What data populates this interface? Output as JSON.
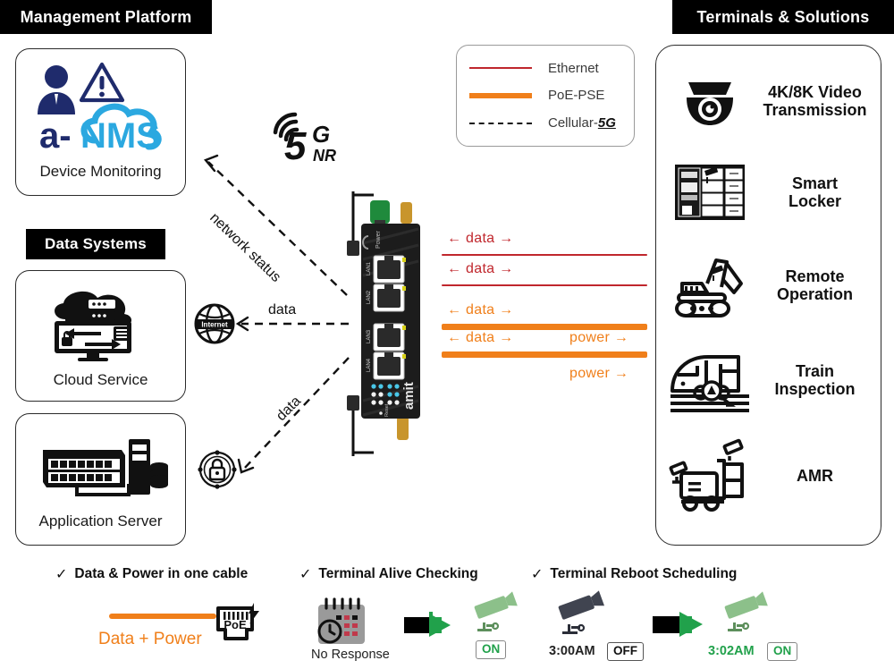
{
  "sections": {
    "management_platform": "Management Platform",
    "data_systems": "Data Systems",
    "terminals_solutions": "Terminals & Solutions"
  },
  "colors": {
    "ethernet_red": "#C0272D",
    "poe_orange": "#F07F1A",
    "cellular_black": "#111111",
    "logo_navy": "#1F2B6C",
    "logo_cyan": "#2BA8E0",
    "green": "#21A14B"
  },
  "cards": {
    "device_monitoring": {
      "label": "Device Monitoring",
      "logo_a": "a-",
      "logo_nms": "NMS"
    },
    "cloud_service": {
      "label": "Cloud Service"
    },
    "application_server": {
      "label": "Application Server"
    }
  },
  "legend": {
    "items": [
      {
        "label": "Ethernet",
        "style": "solid",
        "color": "#C0272D",
        "thickness": 2
      },
      {
        "label": "PoE-PSE",
        "style": "solid",
        "color": "#F07F1A",
        "thickness": 6
      },
      {
        "label": "Cellular-",
        "emphasis": "5G",
        "style": "dashed",
        "color": "#111111",
        "thickness": 2
      }
    ]
  },
  "center": {
    "cellular_badge": {
      "main": "5",
      "sup": "G",
      "sub": "NR"
    },
    "router_brand": "amit",
    "router_ports": [
      "LAN1",
      "LAN2",
      "LAN3",
      "LAN4"
    ],
    "router_power_label": "Power",
    "router_reset_label": "Reset"
  },
  "links": [
    {
      "name": "network-status",
      "label": "network status",
      "style": "dashed"
    },
    {
      "name": "internet-data",
      "label": "data",
      "style": "dashed",
      "icon": "internet-globe-icon",
      "icon_text": "Internet"
    },
    {
      "name": "vpn-data",
      "label": "data",
      "style": "dashed",
      "icon": "security-lock-icon"
    }
  ],
  "flows": [
    {
      "id": "eth-1",
      "left": "← data →",
      "right": "",
      "line": "ethernet",
      "color": "#C0272D"
    },
    {
      "id": "eth-2",
      "left": "← data →",
      "right": "",
      "line": "ethernet",
      "color": "#C0272D"
    },
    {
      "id": "poe-1",
      "left": "← data →",
      "right": "",
      "line": "poe",
      "color": "#F07F1A"
    },
    {
      "id": "poe-2",
      "left": "← data →",
      "right": "power →",
      "line": "poe",
      "color": "#F07F1A"
    },
    {
      "id": "poe-3",
      "left": "",
      "right": "power →",
      "line": "none",
      "color": "#F07F1A"
    }
  ],
  "terminals": [
    {
      "icon": "dome-camera-icon",
      "label": "4K/8K Video\nTransmission"
    },
    {
      "icon": "smart-locker-icon",
      "label": "Smart\nLocker"
    },
    {
      "icon": "excavator-icon",
      "label": "Remote\nOperation"
    },
    {
      "icon": "train-icon",
      "label": "Train\nInspection"
    },
    {
      "icon": "amr-robot-icon",
      "label": "AMR"
    }
  ],
  "features": [
    {
      "id": "data-power-one-cable",
      "tick": "✓",
      "title": "Data & Power in one cable",
      "caption": "Data + Power",
      "badge": "PoE"
    },
    {
      "id": "terminal-alive-checking",
      "tick": "✓",
      "title": "Terminal  Alive Checking",
      "caption": "No Response",
      "state": "ON"
    },
    {
      "id": "terminal-reboot-scheduling",
      "tick": "✓",
      "title": "Terminal  Reboot Scheduling",
      "time_off": "3:00AM",
      "state_off": "OFF",
      "time_on": "3:02AM",
      "state_on": "ON"
    }
  ]
}
